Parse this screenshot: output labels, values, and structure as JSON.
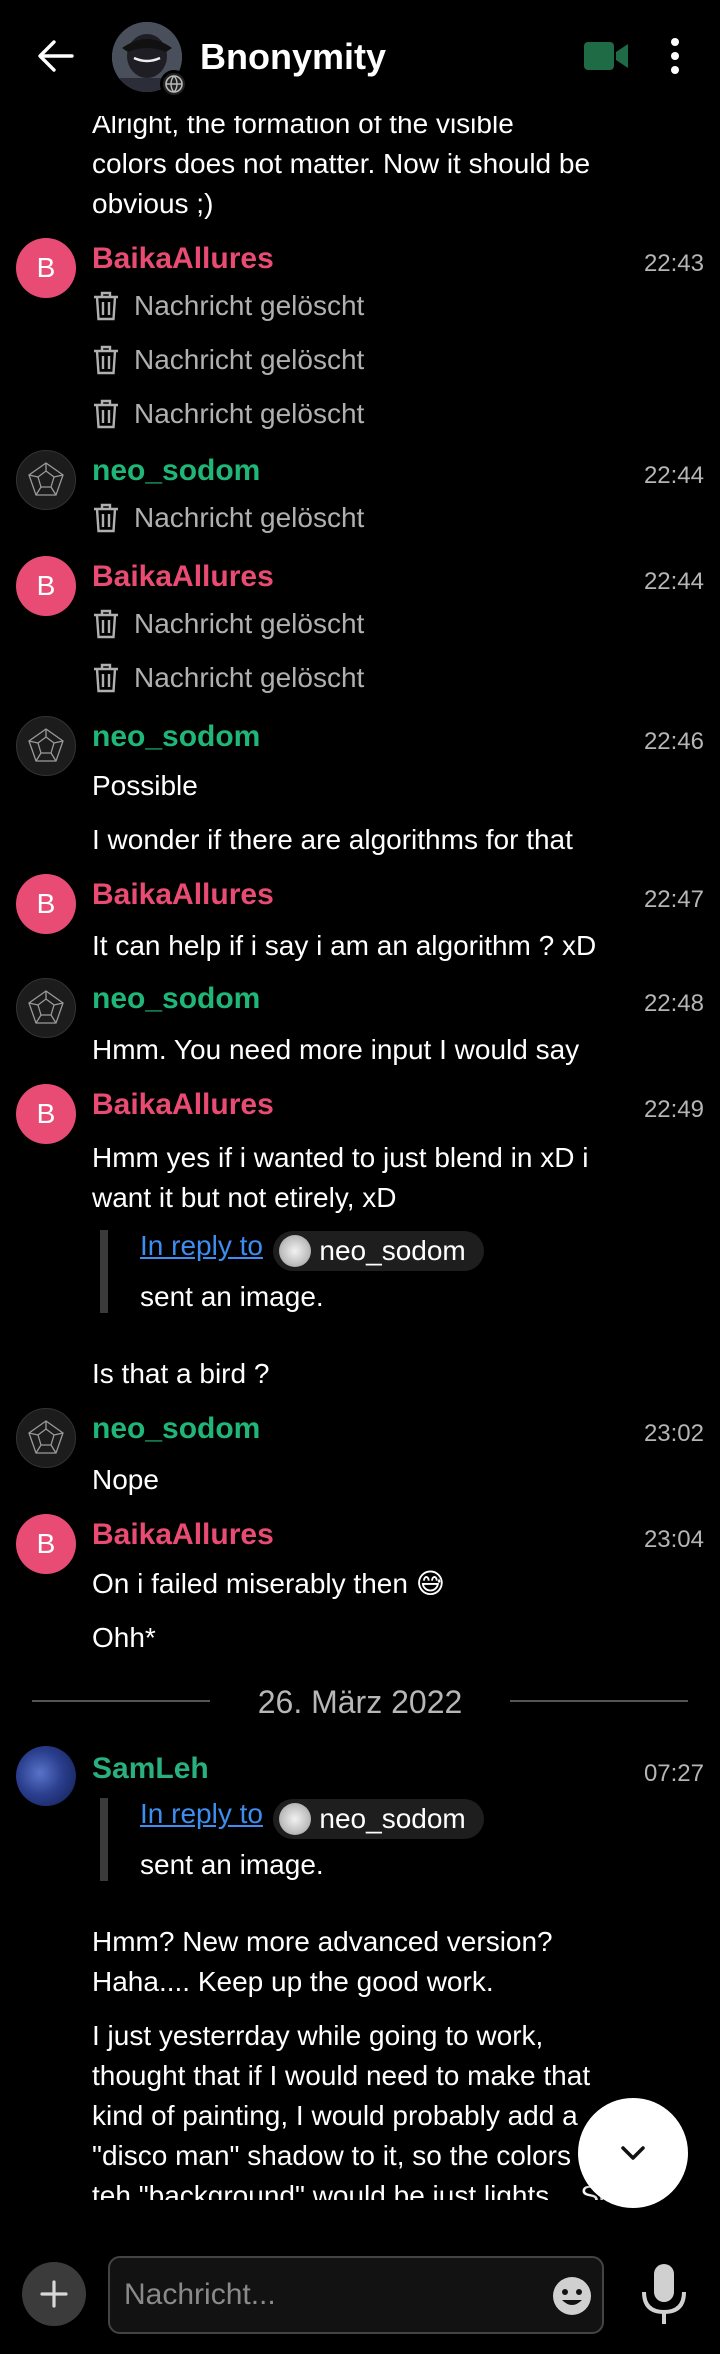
{
  "header": {
    "title": "Bnonymity",
    "back_icon": "arrow-left-icon",
    "video_icon": "video-camera-icon",
    "menu_icon": "more-vertical-icon"
  },
  "messages": {
    "m0": {
      "line1": "Alright, the formation of the visible",
      "line2": "colors does not matter. Now it should be",
      "line3": "obvious ;)"
    },
    "g1": {
      "avatar_letter": "B",
      "sender": "BaikaAllures",
      "time": "22:43",
      "deleted": [
        "Nachricht gelöscht",
        "Nachricht gelöscht",
        "Nachricht gelöscht"
      ]
    },
    "g2": {
      "sender": "neo_sodom",
      "time": "22:44",
      "deleted": [
        "Nachricht gelöscht"
      ]
    },
    "g3": {
      "avatar_letter": "B",
      "sender": "BaikaAllures",
      "time": "22:44",
      "deleted": [
        "Nachricht gelöscht",
        "Nachricht gelöscht"
      ]
    },
    "g4": {
      "sender": "neo_sodom",
      "time": "22:46",
      "text1": "Possible",
      "text2": "I wonder if there are algorithms for that"
    },
    "g5": {
      "avatar_letter": "B",
      "sender": "BaikaAllures",
      "time": "22:47",
      "text1": "It can help if i say i am an algorithm ? xD"
    },
    "g6": {
      "sender": "neo_sodom",
      "time": "22:48",
      "text1": "Hmm. You need more input I would say"
    },
    "g7": {
      "avatar_letter": "B",
      "sender": "BaikaAllures",
      "time": "22:49",
      "line1": "Hmm yes if i wanted to just blend in xD i",
      "line2": "want it but not etirely, xD",
      "reply_link": "In reply to",
      "reply_user": "neo_sodom",
      "reply_text": "sent an image.",
      "text2": "Is that a bird ?"
    },
    "g8": {
      "sender": "neo_sodom",
      "time": "23:02",
      "text1": "Nope"
    },
    "g9": {
      "avatar_letter": "B",
      "sender": "BaikaAllures",
      "time": "23:04",
      "text1": "On i failed miserably then 😅",
      "text2": "Ohh*"
    },
    "date_divider": "26. März 2022",
    "g10": {
      "sender": "SamLeh",
      "time": "07:27",
      "reply_link": "In reply to",
      "reply_user": "neo_sodom",
      "reply_text": "sent an image.",
      "p1_line1": "Hmm? New more advanced version?",
      "p1_line2": "Haha.... Keep up the good work.",
      "p2_line1": "I just yesterrday while going to work,",
      "p2_line2": "thought that if I would need to make that",
      "p2_line3": "kind of painting, I would probably add a",
      "p2_line4": "\"disco man\" shadow to it, so the colors",
      "p2_line5": "teh \"background\" would be just lights... So"
    }
  },
  "composer": {
    "placeholder": "Nachricht...",
    "add_icon": "plus-icon",
    "emoji_icon": "emoji-icon",
    "mic_icon": "microphone-icon"
  },
  "scroll_button_icon": "chevron-down-icon",
  "colors": {
    "pink": "#ea4b73",
    "green": "#1fb678",
    "link": "#3d8ef0",
    "bg": "#000000"
  }
}
